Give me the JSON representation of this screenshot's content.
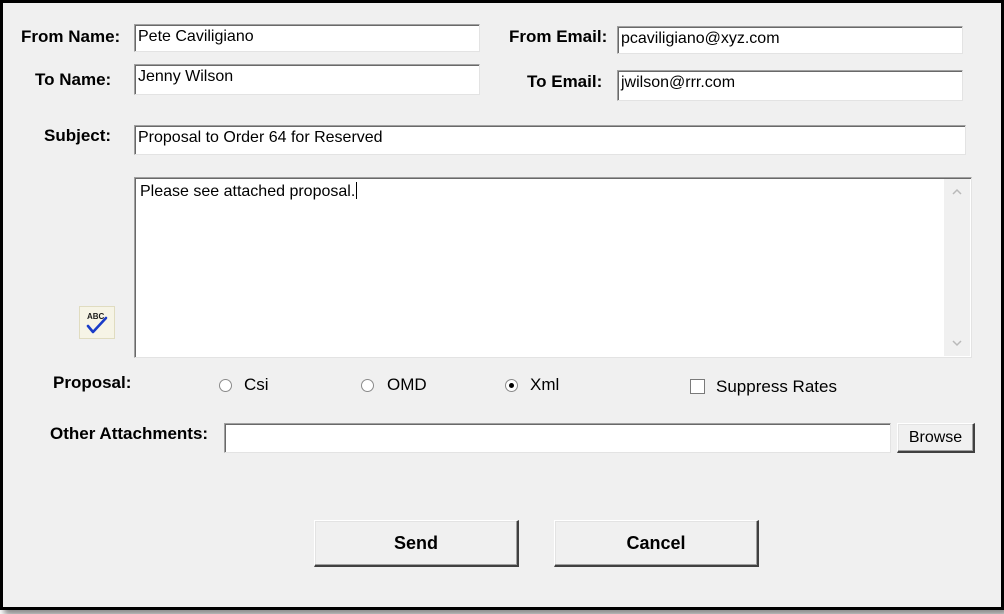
{
  "form": {
    "from_name_label": "From Name:",
    "from_name_value": "Pete Caviligiano",
    "from_email_label": "From Email:",
    "from_email_value": "pcaviligiano@xyz.com",
    "to_name_label": "To Name:",
    "to_name_value": "Jenny Wilson",
    "to_email_label": "To Email:",
    "to_email_value": "jwilson@rrr.com",
    "subject_label": "Subject:",
    "subject_value": "Proposal to Order 64 for Reserved",
    "body_value": "Please see attached proposal."
  },
  "spellcheck": {
    "icon": "spellcheck-icon",
    "glyph_text": "ABC"
  },
  "proposal": {
    "label": "Proposal:",
    "options": [
      {
        "label": "Csi",
        "selected": false
      },
      {
        "label": "OMD",
        "selected": false
      },
      {
        "label": "Xml",
        "selected": true
      }
    ],
    "suppress_rates_label": "Suppress Rates",
    "suppress_rates_checked": false
  },
  "attachments": {
    "label": "Other Attachments:",
    "value": "",
    "browse_label": "Browse"
  },
  "buttons": {
    "send_label": "Send",
    "cancel_label": "Cancel"
  }
}
